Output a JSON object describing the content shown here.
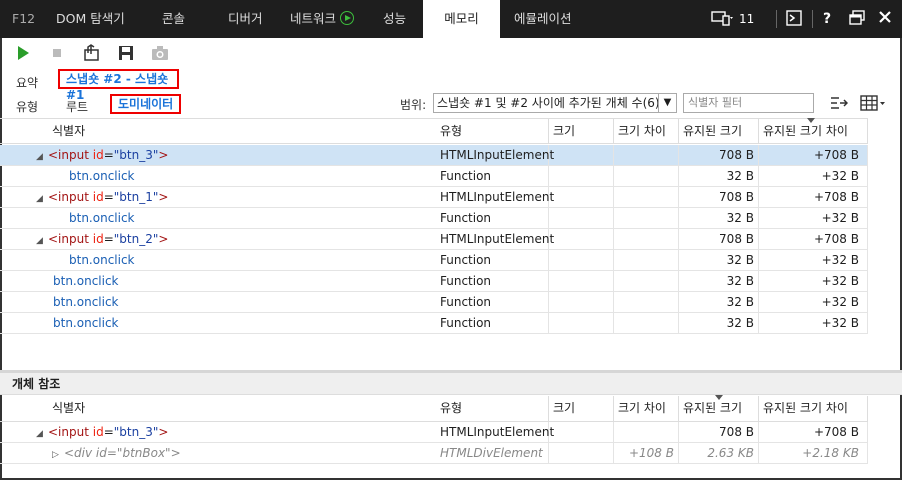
{
  "titlebar": {
    "f12": "F12",
    "tabs": [
      "DOM 탐색기",
      "콘솔",
      "디버거",
      "네트워크",
      "성능",
      "메모리",
      "에뮬레이션"
    ],
    "active_tab": "메모리",
    "device_count": "11",
    "help": "?"
  },
  "toolbar": {
    "icons": [
      "start-icon",
      "stop-icon",
      "import-icon",
      "save-icon",
      "camera-icon"
    ]
  },
  "summary": {
    "label": "요약",
    "snapshot_compare": "스냅숏 #2 - 스냅숏 #1"
  },
  "view": {
    "label": "유형",
    "root": "루트",
    "dominator": "도미네이터",
    "scope_label": "범위:",
    "scope_value": "스냅숏 #1 및 #2 사이에 추가된 개체 수(6)",
    "filter_placeholder": "식별자 필터"
  },
  "columns": {
    "id": "식별자",
    "type": "유형",
    "size": "크기",
    "size_diff": "크기 차이",
    "retained": "유지된 크기",
    "retained_diff": "유지된 크기 차이"
  },
  "rows": [
    {
      "tag": "<input",
      "attr": "id",
      "eq": "=",
      "val": "\"btn_3\"",
      "close": ">",
      "type": "HTMLInputElement",
      "size": "",
      "size_diff": "",
      "retained": "708 B",
      "retained_diff": "+708 B"
    },
    {
      "text": "btn.onclick",
      "type": "Function",
      "retained": "32 B",
      "retained_diff": "+32 B"
    },
    {
      "tag": "<input",
      "attr": "id",
      "eq": "=",
      "val": "\"btn_1\"",
      "close": ">",
      "type": "HTMLInputElement",
      "retained": "708 B",
      "retained_diff": "+708 B"
    },
    {
      "text": "btn.onclick",
      "type": "Function",
      "retained": "32 B",
      "retained_diff": "+32 B"
    },
    {
      "tag": "<input",
      "attr": "id",
      "eq": "=",
      "val": "\"btn_2\"",
      "close": ">",
      "type": "HTMLInputElement",
      "retained": "708 B",
      "retained_diff": "+708 B"
    },
    {
      "text": "btn.onclick",
      "type": "Function",
      "retained": "32 B",
      "retained_diff": "+32 B"
    },
    {
      "text": "btn.onclick",
      "type": "Function",
      "retained": "32 B",
      "retained_diff": "+32 B"
    },
    {
      "text": "btn.onclick",
      "type": "Function",
      "retained": "32 B",
      "retained_diff": "+32 B"
    },
    {
      "text": "btn.onclick",
      "type": "Function",
      "retained": "32 B",
      "retained_diff": "+32 B"
    }
  ],
  "references": {
    "title": "개체 참조",
    "rows": [
      {
        "tag": "<input",
        "attr": "id",
        "eq": "=",
        "val": "\"btn_3\"",
        "close": ">",
        "type": "HTMLInputElement",
        "retained": "708 B",
        "retained_diff": "+708 B"
      },
      {
        "text": "<div id=\"btnBox\">",
        "type": "HTMLDivElement",
        "size_diff": "+108 B",
        "retained": "2.63 KB",
        "retained_diff": "+2.18 KB"
      }
    ]
  }
}
